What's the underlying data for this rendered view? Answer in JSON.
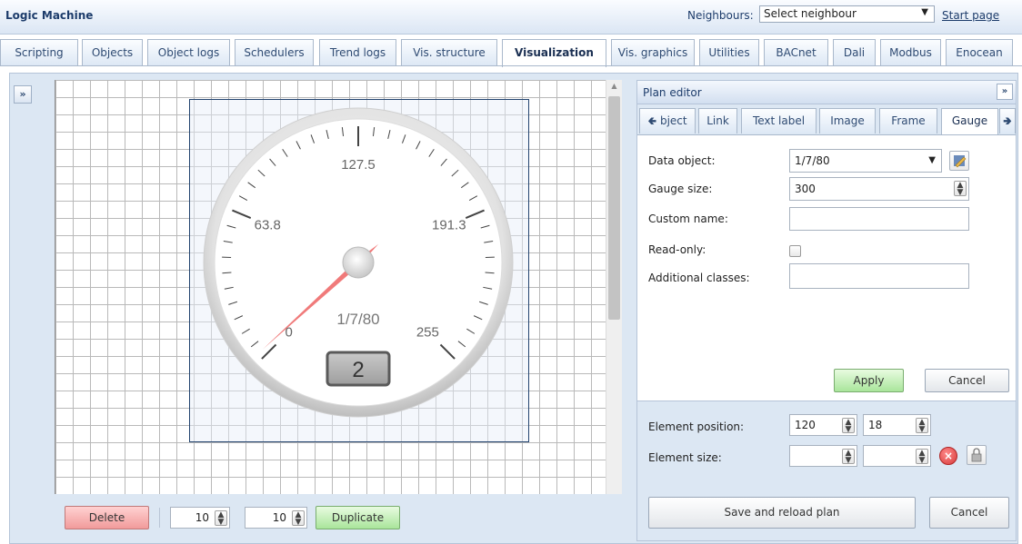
{
  "app": {
    "title": "Logic Machine"
  },
  "neighbours": {
    "label": "Neighbours:",
    "selected": "Select neighbour"
  },
  "start_page": "Start page",
  "tabs": [
    {
      "label": "Scripting"
    },
    {
      "label": "Objects"
    },
    {
      "label": "Object logs"
    },
    {
      "label": "Schedulers"
    },
    {
      "label": "Trend logs"
    },
    {
      "label": "Vis. structure"
    },
    {
      "label": "Visualization"
    },
    {
      "label": "Vis. graphics"
    },
    {
      "label": "Utilities"
    },
    {
      "label": "BACnet"
    },
    {
      "label": "Dali"
    },
    {
      "label": "Modbus"
    },
    {
      "label": "Enocean"
    }
  ],
  "active_tab": "Visualization",
  "gauge": {
    "object": "1/7/80",
    "min": "0",
    "max": "255",
    "tick_labels": [
      "63.8",
      "127.5",
      "191.3"
    ],
    "value": "2",
    "needle_fraction": 0.01
  },
  "bottom_toolbar": {
    "delete_label": "Delete",
    "step_x": "10",
    "step_y": "10",
    "duplicate_label": "Duplicate"
  },
  "plan_editor": {
    "title": "Plan editor",
    "tabs": [
      {
        "label": "bject"
      },
      {
        "label": "Link"
      },
      {
        "label": "Text label"
      },
      {
        "label": "Image"
      },
      {
        "label": "Frame"
      },
      {
        "label": "Gauge"
      }
    ],
    "active_tab": "Gauge",
    "fields": {
      "data_object_label": "Data object:",
      "data_object_value": "1/7/80",
      "gauge_size_label": "Gauge size:",
      "gauge_size_value": "300",
      "custom_name_label": "Custom name:",
      "custom_name_value": "",
      "read_only_label": "Read-only:",
      "additional_classes_label": "Additional classes:",
      "additional_classes_value": ""
    },
    "apply_label": "Apply",
    "cancel_label": "Cancel",
    "element_position_label": "Element position:",
    "element_position_x": "120",
    "element_position_y": "18",
    "element_size_label": "Element size:",
    "element_size_w": "",
    "element_size_h": "",
    "save_label": "Save and reload plan",
    "cancel2_label": "Cancel"
  },
  "colors": {
    "accent": "#1d3c6b",
    "apply_green": "#a9e59b",
    "delete_red": "#f19b9b",
    "needle": "#ee6b6b"
  }
}
